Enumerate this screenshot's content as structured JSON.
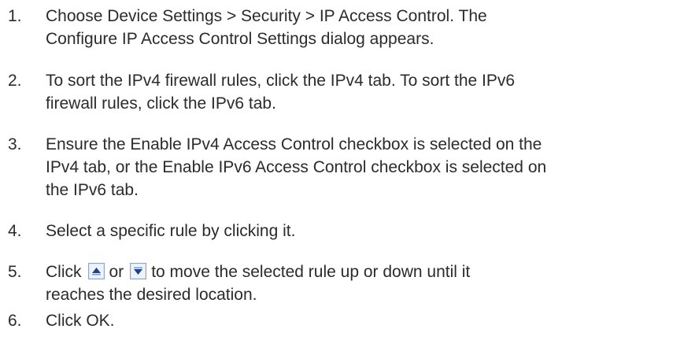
{
  "steps": [
    {
      "number": "1.",
      "line1": "Choose Device Settings > Security > IP Access Control. The",
      "line2": "Configure IP Access Control Settings dialog appears."
    },
    {
      "number": "2.",
      "line1": "To sort the IPv4 firewall rules, click the IPv4 tab. To sort the IPv6",
      "line2": "firewall rules, click the IPv6 tab."
    },
    {
      "number": "3.",
      "line1": "Ensure the Enable IPv4 Access Control checkbox is selected on the",
      "line2": "IPv4 tab, or the Enable IPv6 Access Control checkbox is selected on",
      "line3": "the IPv6 tab."
    },
    {
      "number": "4.",
      "line1": "Select a specific rule by clicking it."
    },
    {
      "number": "5.",
      "part1": "Click",
      "part2": "or",
      "part3": "to move the selected rule up or down until it",
      "line2": "reaches the desired location."
    },
    {
      "number": "6.",
      "line1": "Click OK."
    }
  ],
  "icons": {
    "move_up": "move-up-icon",
    "move_down": "move-down-icon",
    "icon_bg": "#dde6f2",
    "icon_border": "#8fa6c4",
    "icon_arrow": "#1f3f8f"
  }
}
